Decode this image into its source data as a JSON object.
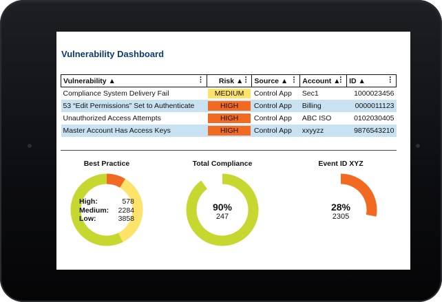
{
  "dashboard": {
    "title": "Vulnerability Dashboard"
  },
  "table": {
    "headers": [
      {
        "label": "Vulnerability ▲",
        "menu": "⋮"
      },
      {
        "label": "Risk ▲",
        "menu": "⋮"
      },
      {
        "label": "Source ▲",
        "menu": "⋮"
      },
      {
        "label": "Account ▲",
        "menu": "⋮"
      },
      {
        "label": "ID ▲",
        "menu": "⋮"
      }
    ],
    "rows": [
      {
        "vulnerability": "Compliance System Delivery Fail",
        "risk": "MEDIUM",
        "risk_color": "#fde36a",
        "source": "Control App",
        "account": "Sec1",
        "id": "1000023456"
      },
      {
        "vulnerability": "53 “Edit Permissions” Set to Authenticate",
        "risk": "HIGH",
        "risk_color": "#f26a21",
        "source": "Control App",
        "account": "Billing",
        "id": "0000011123"
      },
      {
        "vulnerability": "Unauthorized Access Attempts",
        "risk": "HIGH",
        "risk_color": "#f26a21",
        "source": "Control App",
        "account": "ABC ISO",
        "id": "0102030405"
      },
      {
        "vulnerability": "Master Account Has Access Keys",
        "risk": "HIGH",
        "risk_color": "#f26a21",
        "source": "Control App",
        "account": "xxyyzz",
        "id": "9876543210"
      }
    ]
  },
  "gauges": {
    "best_practice": {
      "title": "Best Practice",
      "legend": [
        {
          "label": "High:",
          "value": "578"
        },
        {
          "label": "Medium:",
          "value": "2284"
        },
        {
          "label": "Low:",
          "value": "3858"
        }
      ],
      "segments": [
        {
          "name": "High",
          "value": 578,
          "color": "#f26a21"
        },
        {
          "name": "Medium",
          "value": 2284,
          "color": "#fde36a"
        },
        {
          "name": "Low",
          "value": 3858,
          "color": "#c6d82f"
        }
      ]
    },
    "total_compliance": {
      "title": "Total Compliance",
      "percent_label": "90%",
      "count": "247",
      "fraction": 0.9,
      "color": "#c6d82f"
    },
    "event_id": {
      "title": "Event ID XYZ",
      "percent_label": "28%",
      "count": "2305",
      "fraction": 0.28,
      "color": "#f26a21"
    }
  }
}
